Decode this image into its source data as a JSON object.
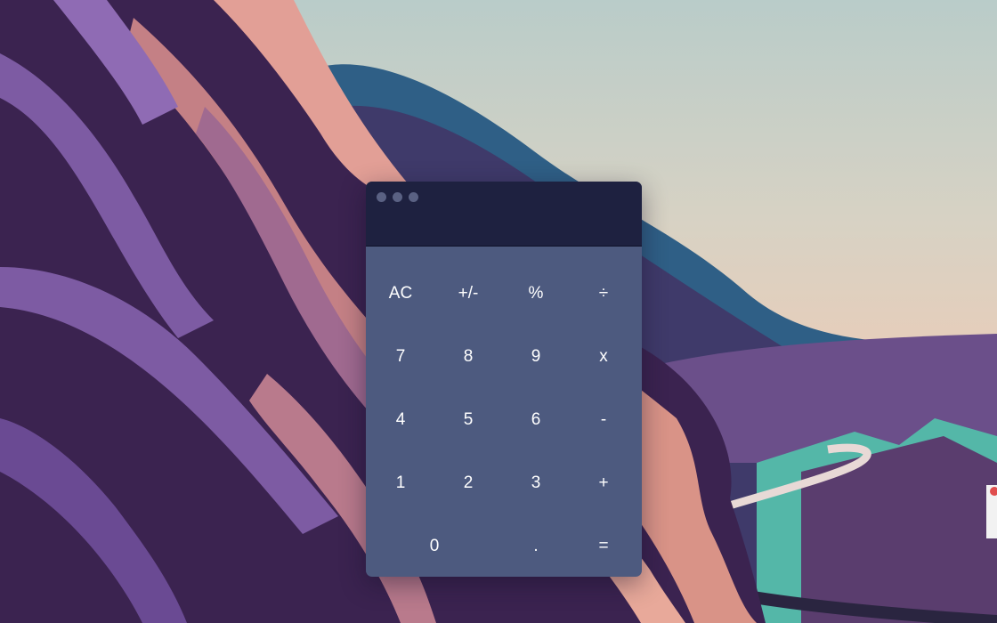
{
  "calculator": {
    "display_value": "",
    "window_controls": [
      "window-dot",
      "window-dot",
      "window-dot"
    ],
    "rows": [
      [
        {
          "label": "AC",
          "name": "all-clear-button"
        },
        {
          "label": "+/-",
          "name": "toggle-sign-button"
        },
        {
          "label": "%",
          "name": "percent-button"
        },
        {
          "label": "÷",
          "name": "divide-button"
        }
      ],
      [
        {
          "label": "7",
          "name": "digit-7-button"
        },
        {
          "label": "8",
          "name": "digit-8-button"
        },
        {
          "label": "9",
          "name": "digit-9-button"
        },
        {
          "label": "x",
          "name": "multiply-button"
        }
      ],
      [
        {
          "label": "4",
          "name": "digit-4-button"
        },
        {
          "label": "5",
          "name": "digit-5-button"
        },
        {
          "label": "6",
          "name": "digit-6-button"
        },
        {
          "label": "-",
          "name": "subtract-button"
        }
      ],
      [
        {
          "label": "1",
          "name": "digit-1-button"
        },
        {
          "label": "2",
          "name": "digit-2-button"
        },
        {
          "label": "3",
          "name": "digit-3-button"
        },
        {
          "label": "+",
          "name": "add-button"
        }
      ],
      [
        {
          "label": "0",
          "name": "digit-0-button"
        },
        {
          "label": ".",
          "name": "decimal-button"
        },
        {
          "label": "=",
          "name": "equals-button"
        }
      ]
    ]
  },
  "colors": {
    "titlebar": "#1e2140",
    "keypad": "#4d5a7f",
    "key_text": "#ffffff"
  }
}
